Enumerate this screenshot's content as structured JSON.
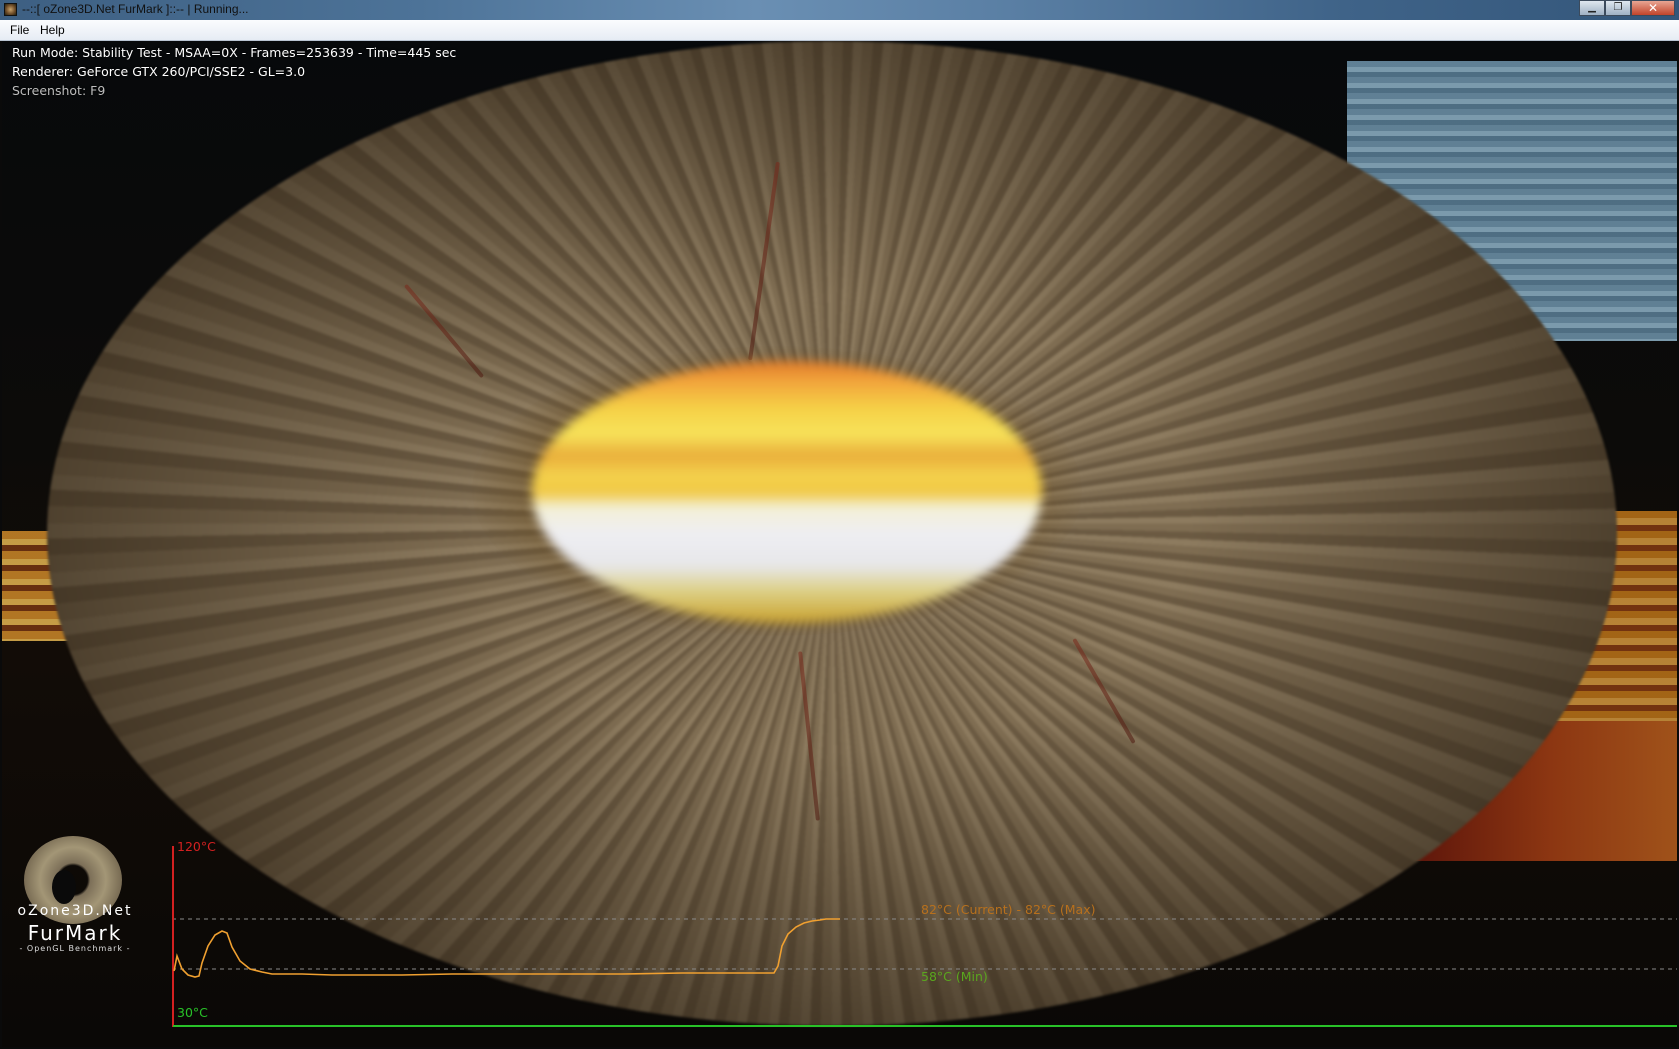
{
  "window": {
    "title": "--::[ oZone3D.Net FurMark ]::-- | Running...",
    "buttons": {
      "minimize": "▁",
      "maximize": "❐",
      "close": "✕"
    }
  },
  "menu": {
    "items": [
      "File",
      "Help"
    ]
  },
  "osd": {
    "run_mode": "Run Mode: Stability Test - MSAA=0X - Frames=253639 - Time=445 sec",
    "renderer": "Renderer: GeForce GTX 260/PCI/SSE2 - GL=3.0",
    "screenshot_hint": "Screenshot: F9"
  },
  "temperature_graph": {
    "max_axis_label": "120°C",
    "min_axis_label": "30°C",
    "current_max_label": "82°C (Current) - 82°C (Max)",
    "min_label": "58°C (Min)",
    "colors": {
      "axis_y": "#d32020",
      "axis_x": "#28c228",
      "curve": "#f0a030",
      "current_label": "#b7701d",
      "min_label": "#5aa61e",
      "guide": "#8a8a8a"
    }
  },
  "logo": {
    "line1": "oZone3D.Net",
    "line2": "FurMark",
    "line3": "- OpenGL Benchmark -"
  }
}
